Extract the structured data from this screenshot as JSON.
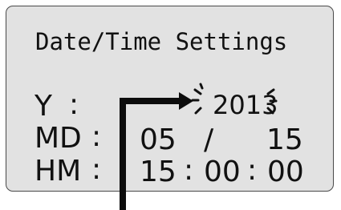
{
  "screen": {
    "title": "Date/Time Settings",
    "year": {
      "label": "Y",
      "separator": ":",
      "value": "2013"
    },
    "month_day": {
      "label": "MD",
      "separator": ":",
      "month": "05",
      "divider": "/",
      "day": "15"
    },
    "hour_minute": {
      "label": "HM",
      "separator": ":",
      "hour": "15",
      "colon1": ":",
      "minute": "00",
      "colon2": ":",
      "second": "00"
    }
  },
  "annotation": {
    "arrow_icon": "arrow-pointer-icon",
    "highlight_icon": "blink-marks-icon"
  },
  "colors": {
    "screen_bg": "#e2e2e2",
    "text": "#111111",
    "arrow": "#0c0c0c"
  }
}
